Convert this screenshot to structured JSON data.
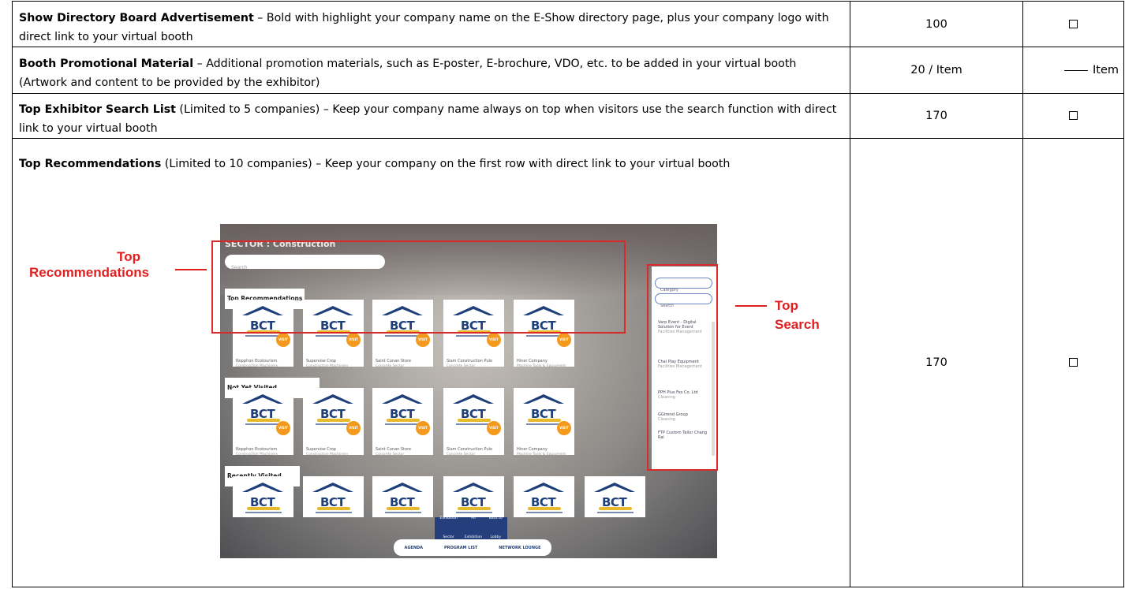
{
  "rows": [
    {
      "title": "Show Directory Board Advertisement",
      "text": " – Bold with highlight your company name on the E-Show directory page, plus your company logo with direct link to your virtual booth",
      "price": "100",
      "selector": "checkbox"
    },
    {
      "title": "Booth Promotional Material",
      "text": " – Additional promotion materials, such as E-poster, E-brochure, VDO, etc. to be added in your virtual booth (Artwork and content to be provided by the exhibitor)",
      "price": "20 / Item",
      "selector_label": "Item"
    },
    {
      "title": "Top Exhibitor Search List",
      "text": " (Limited to 5 companies) – Keep your company name always on top when visitors use the search function with direct link to your virtual booth",
      "price": "170",
      "selector": "checkbox"
    },
    {
      "title": "Top Recommendations",
      "text": " (Limited to 10 companies) – Keep your company on the first row with direct link to your virtual booth",
      "price": "170",
      "selector": "checkbox"
    }
  ],
  "screenshot": {
    "sector_label": "SECTOR : Construction",
    "search_placeholder": "Search",
    "section_top": "Top Recommendations",
    "section_not_visited": "Not Yet Visited",
    "section_recent": "Recently Visited",
    "logo_text": "BCT",
    "visit_label": "VISIT",
    "cards": [
      {
        "name": "Nopphon Ecotourism",
        "category": "Construction Machinery"
      },
      {
        "name": "Supervise Crop",
        "category": "Construction Machinery"
      },
      {
        "name": "Saint Conan Store",
        "category": "Concrete Sector"
      },
      {
        "name": "Siam Construction Pulo",
        "category": "Concrete Sector"
      },
      {
        "name": "Hiner Company",
        "category": "Machine Tools & Equipment"
      }
    ],
    "side_panel": {
      "category_placeholder": "Category",
      "search_placeholder": "Search",
      "entries": [
        {
          "name": "Varp Event - Digital Solution for Event",
          "category": "Facilities Management"
        },
        {
          "name": "Chai Play Equipment",
          "category": "Facilities Management"
        },
        {
          "name": "PPH Plus Fes Co. Ltd",
          "category": "Cleaning"
        },
        {
          "name": "GGtrend Group",
          "category": "Cleaning"
        },
        {
          "name": "FTP Custom Tailor Chang Rai",
          "category": ""
        }
      ]
    },
    "nav": [
      {
        "label": "Exhibition Sector"
      },
      {
        "label": "All Exhibition"
      },
      {
        "label": "Back to Lobby"
      }
    ],
    "bottom": [
      {
        "label": "AGENDA"
      },
      {
        "label": "PROGRAM LIST"
      },
      {
        "label": "NETWORK LOUNGE"
      }
    ]
  },
  "callouts": {
    "left": "Top\nRecommendations",
    "left_line1": "Top",
    "left_line2": "Recommendations",
    "right": "Top Search"
  },
  "colors": {
    "callout": "#e02020",
    "brand_blue": "#1f3f7a",
    "visit_orange": "#f39a1e"
  }
}
